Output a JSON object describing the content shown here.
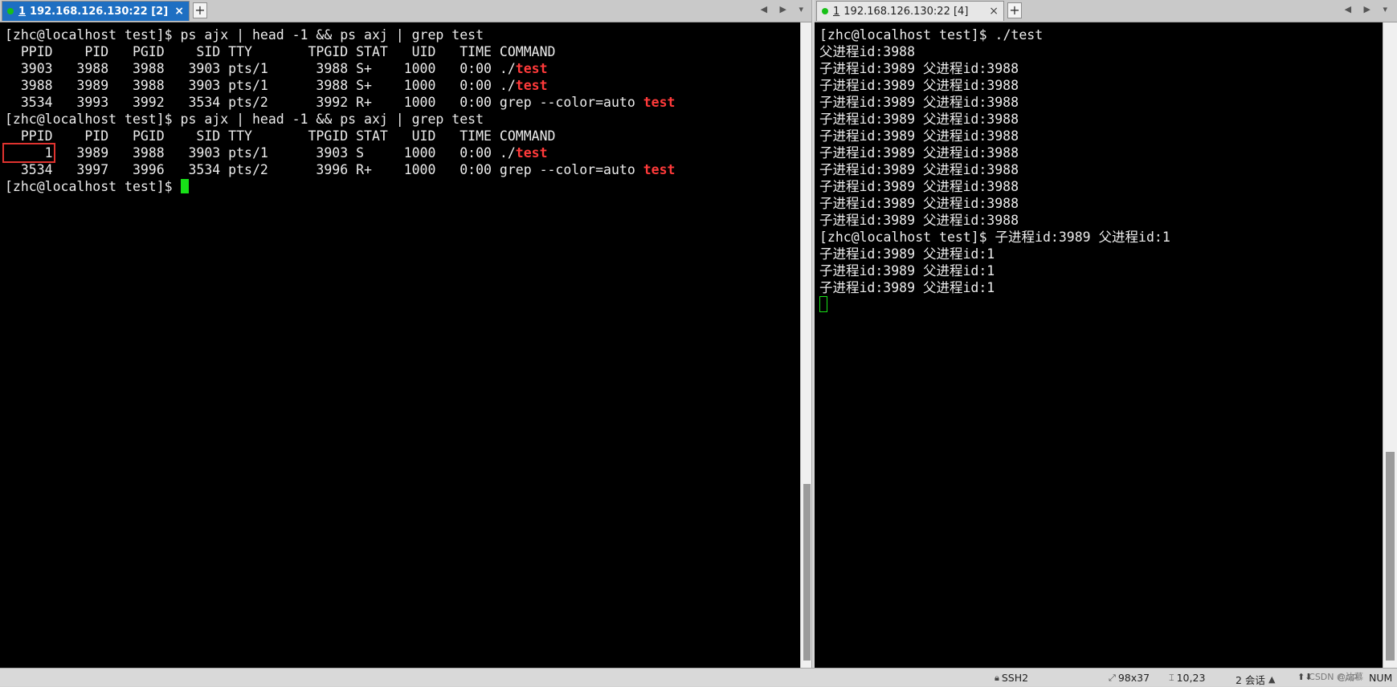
{
  "left_pane": {
    "tab": {
      "number": "1",
      "title": "192.168.126.130:22 [2]",
      "close": "×"
    },
    "add_tab": "+",
    "nav": "◀ ▶ ▾",
    "lines": [
      [
        "[zhc@localhost test]$ ps ajx | head -1 && ps axj | grep test"
      ],
      [
        "  PPID    PID   PGID    SID TTY       TPGID STAT   UID   TIME COMMAND"
      ],
      [
        "  3903   3988   3988   3903 pts/1      3988 S+    1000   0:00 ./",
        "test"
      ],
      [
        "  3988   3989   3988   3903 pts/1      3988 S+    1000   0:00 ./",
        "test"
      ],
      [
        "  3534   3993   3992   3534 pts/2      3992 R+    1000   0:00 grep --color=auto ",
        "test"
      ],
      [
        "[zhc@localhost test]$ ps ajx | head -1 && ps axj | grep test"
      ],
      [
        "  PPID    PID   PGID    SID TTY       TPGID STAT   UID   TIME COMMAND"
      ],
      [
        "",
        "     1",
        "   3989   3988   3903 pts/1      3903 S     1000   0:00 ./",
        "test"
      ],
      [
        "  3534   3997   3996   3534 pts/2      3996 R+    1000   0:00 grep --color=auto ",
        "test"
      ],
      [
        "[zhc@localhost test]$ "
      ]
    ]
  },
  "right_pane": {
    "tab": {
      "number": "1",
      "title": "192.168.126.130:22 [4]",
      "close": "×"
    },
    "add_tab": "+",
    "nav": "◀ ▶ ▾",
    "lines": [
      "[zhc@localhost test]$ ./test",
      "父进程id:3988",
      "子进程id:3989 父进程id:3988",
      "子进程id:3989 父进程id:3988",
      "子进程id:3989 父进程id:3988",
      "子进程id:3989 父进程id:3988",
      "子进程id:3989 父进程id:3988",
      "子进程id:3989 父进程id:3988",
      "子进程id:3989 父进程id:3988",
      "子进程id:3989 父进程id:3988",
      "子进程id:3989 父进程id:3988",
      "子进程id:3989 父进程id:3988",
      "[zhc@localhost test]$ 子进程id:3989 父进程id:1",
      "子进程id:3989 父进程id:1",
      "子进程id:3989 父进程id:1",
      "子进程id:3989 父进程id:1"
    ]
  },
  "statusbar": {
    "protocol": "SSH2",
    "size": "98x37",
    "cursor_pos": "10,23",
    "sessions": "2 会话",
    "cap": "CAP",
    "num": "NUM"
  },
  "watermark": "CSDN @沈慕",
  "colors": {
    "highlight": "#ff3a3a",
    "cursor": "#18e018",
    "active_tab": "#1e6fc2",
    "ppid_box": "#e0332f"
  }
}
